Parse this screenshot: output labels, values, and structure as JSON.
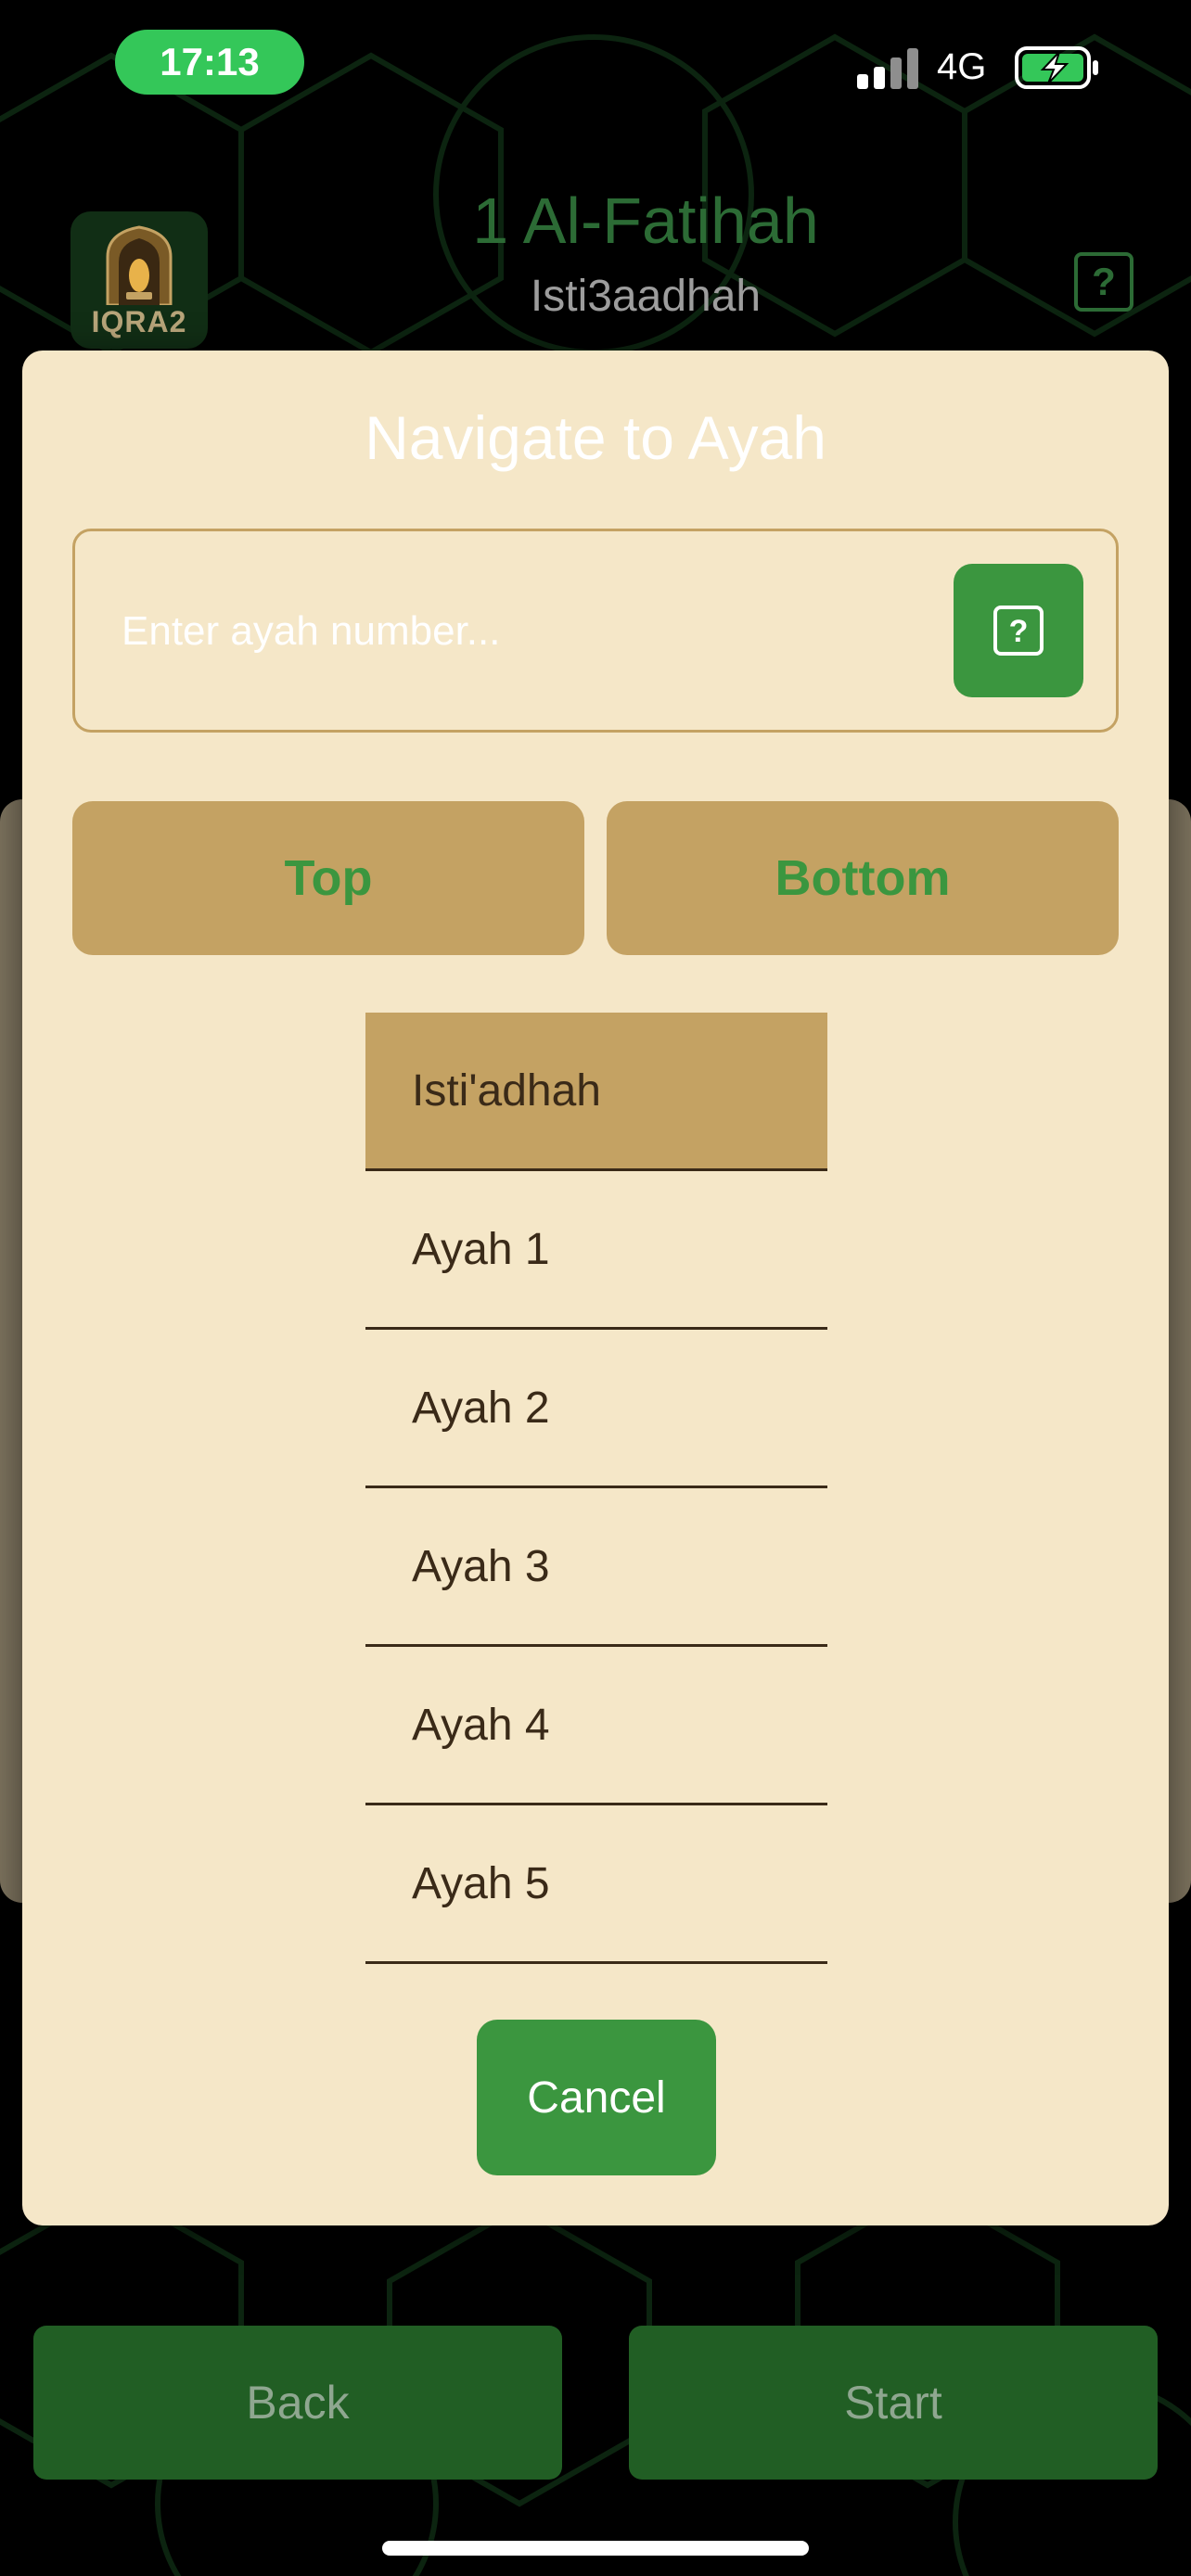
{
  "status_bar": {
    "time": "17:13",
    "network": "4G"
  },
  "header": {
    "logo_text": "IQRA2",
    "surah_title": "1 Al-Fatihah",
    "surah_subtitle": "Isti3aadhah",
    "help_glyph": "?"
  },
  "modal": {
    "title": "Navigate to Ayah",
    "input_placeholder": "Enter ayah number...",
    "input_value": "",
    "top_label": "Top",
    "bottom_label": "Bottom",
    "ayah_items": [
      "Isti'adhah",
      "Ayah 1",
      "Ayah 2",
      "Ayah 3",
      "Ayah 4",
      "Ayah 5"
    ],
    "selected_index": 0,
    "cancel_label": "Cancel"
  },
  "footer": {
    "back_label": "Back",
    "start_label": "Start"
  },
  "colors": {
    "background": "#000000",
    "modal_bg": "#f5e7c8",
    "accent_gold": "#c4a263",
    "accent_green": "#3b963f",
    "dark_green": "#215e24",
    "status_green": "#34c759"
  },
  "icons": {
    "logo": "mosque-lamp-icon",
    "help": "question-mark-icon",
    "signal": "signal-bars-icon",
    "battery": "battery-charging-icon"
  }
}
